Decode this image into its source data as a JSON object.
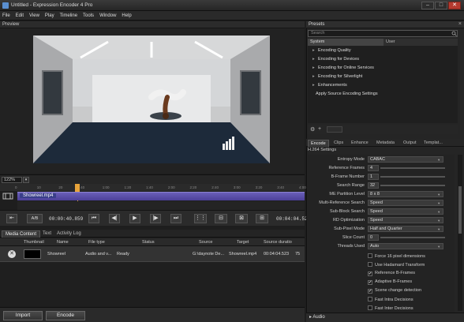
{
  "window": {
    "title": "Untitled - Expression Encoder 4 Pro",
    "minimize": "–",
    "maximize": "□",
    "close": "✕"
  },
  "menu": [
    "File",
    "Edit",
    "View",
    "Play",
    "Timeline",
    "Tools",
    "Window",
    "Help"
  ],
  "preview": {
    "label": "Preview",
    "zoom": "122%"
  },
  "timeline": {
    "ticks": [
      "0",
      "10",
      "20",
      "40",
      "1:00",
      "1:20",
      "1:40",
      "2:00",
      "2:20",
      "2:40",
      "3:00",
      "3:20",
      "3:40",
      "4:00"
    ],
    "clip_name": "Showreel.mp4",
    "playhead_fraction": 0.21
  },
  "transport": {
    "ab_label": "A/B",
    "current_time": "00:00:40.859",
    "end_time": "00:04:04.523"
  },
  "left_tabs": [
    "Media Content",
    "Text",
    "Activity Log"
  ],
  "media_table": {
    "columns": [
      "Thumbnail",
      "Name",
      "File type",
      "Status",
      "Source",
      "Target",
      "Source duratio"
    ],
    "row": {
      "name": "Showreel",
      "file_type": "Audio and v...",
      "status": "Ready",
      "source": "G:\\daynote De...",
      "target": "Showreel.mp4",
      "duration": "00:04:04.523",
      "extra": "75"
    }
  },
  "buttons": {
    "import": "Import",
    "encode": "Encode"
  },
  "presets": {
    "label": "Presets",
    "search_placeholder": "Search",
    "tabs": [
      "System",
      "User"
    ],
    "items": [
      "Encoding Quality",
      "Encoding for Devices",
      "Encoding for Online Services",
      "Encoding for Silverlight",
      "Enhancements",
      "Apply Source Encoding Settings"
    ]
  },
  "encode_tabs": [
    "Encode",
    "Clips",
    "Enhance",
    "Metadata",
    "Output",
    "Templat..."
  ],
  "encode": {
    "section": "H.264 Settings",
    "params": [
      {
        "label": "Entropy Mode",
        "value": "CABAC",
        "kind": "select"
      },
      {
        "label": "Reference Frames",
        "value": "4",
        "kind": "number"
      },
      {
        "label": "B-Frame Number",
        "value": "1",
        "kind": "number"
      },
      {
        "label": "Search Range",
        "value": "32",
        "kind": "number"
      },
      {
        "label": "ME Partition Level",
        "value": "8 x 8",
        "kind": "select"
      },
      {
        "label": "Multi-Reference Search",
        "value": "Speed",
        "kind": "select"
      },
      {
        "label": "Sub-Block Search",
        "value": "Speed",
        "kind": "select"
      },
      {
        "label": "RD Optimization",
        "value": "Speed",
        "kind": "select"
      },
      {
        "label": "Sub-Pixel Mode",
        "value": "Half and Quarter",
        "kind": "select"
      },
      {
        "label": "Slice Count",
        "value": "0",
        "kind": "number"
      },
      {
        "label": "Threads Used",
        "value": "Auto",
        "kind": "select"
      }
    ],
    "checks": [
      {
        "label": "Force 16 pixel dimensions",
        "checked": false
      },
      {
        "label": "Use Hadamard Transform",
        "checked": false
      },
      {
        "label": "Reference B-Frames",
        "checked": true
      },
      {
        "label": "Adaptive B-Frames",
        "checked": true
      },
      {
        "label": "Scene change detection",
        "checked": true
      },
      {
        "label": "Fast Intra Decisions",
        "checked": false
      },
      {
        "label": "Fast Inter Decisions",
        "checked": false
      }
    ],
    "audio_label": "Audio"
  }
}
